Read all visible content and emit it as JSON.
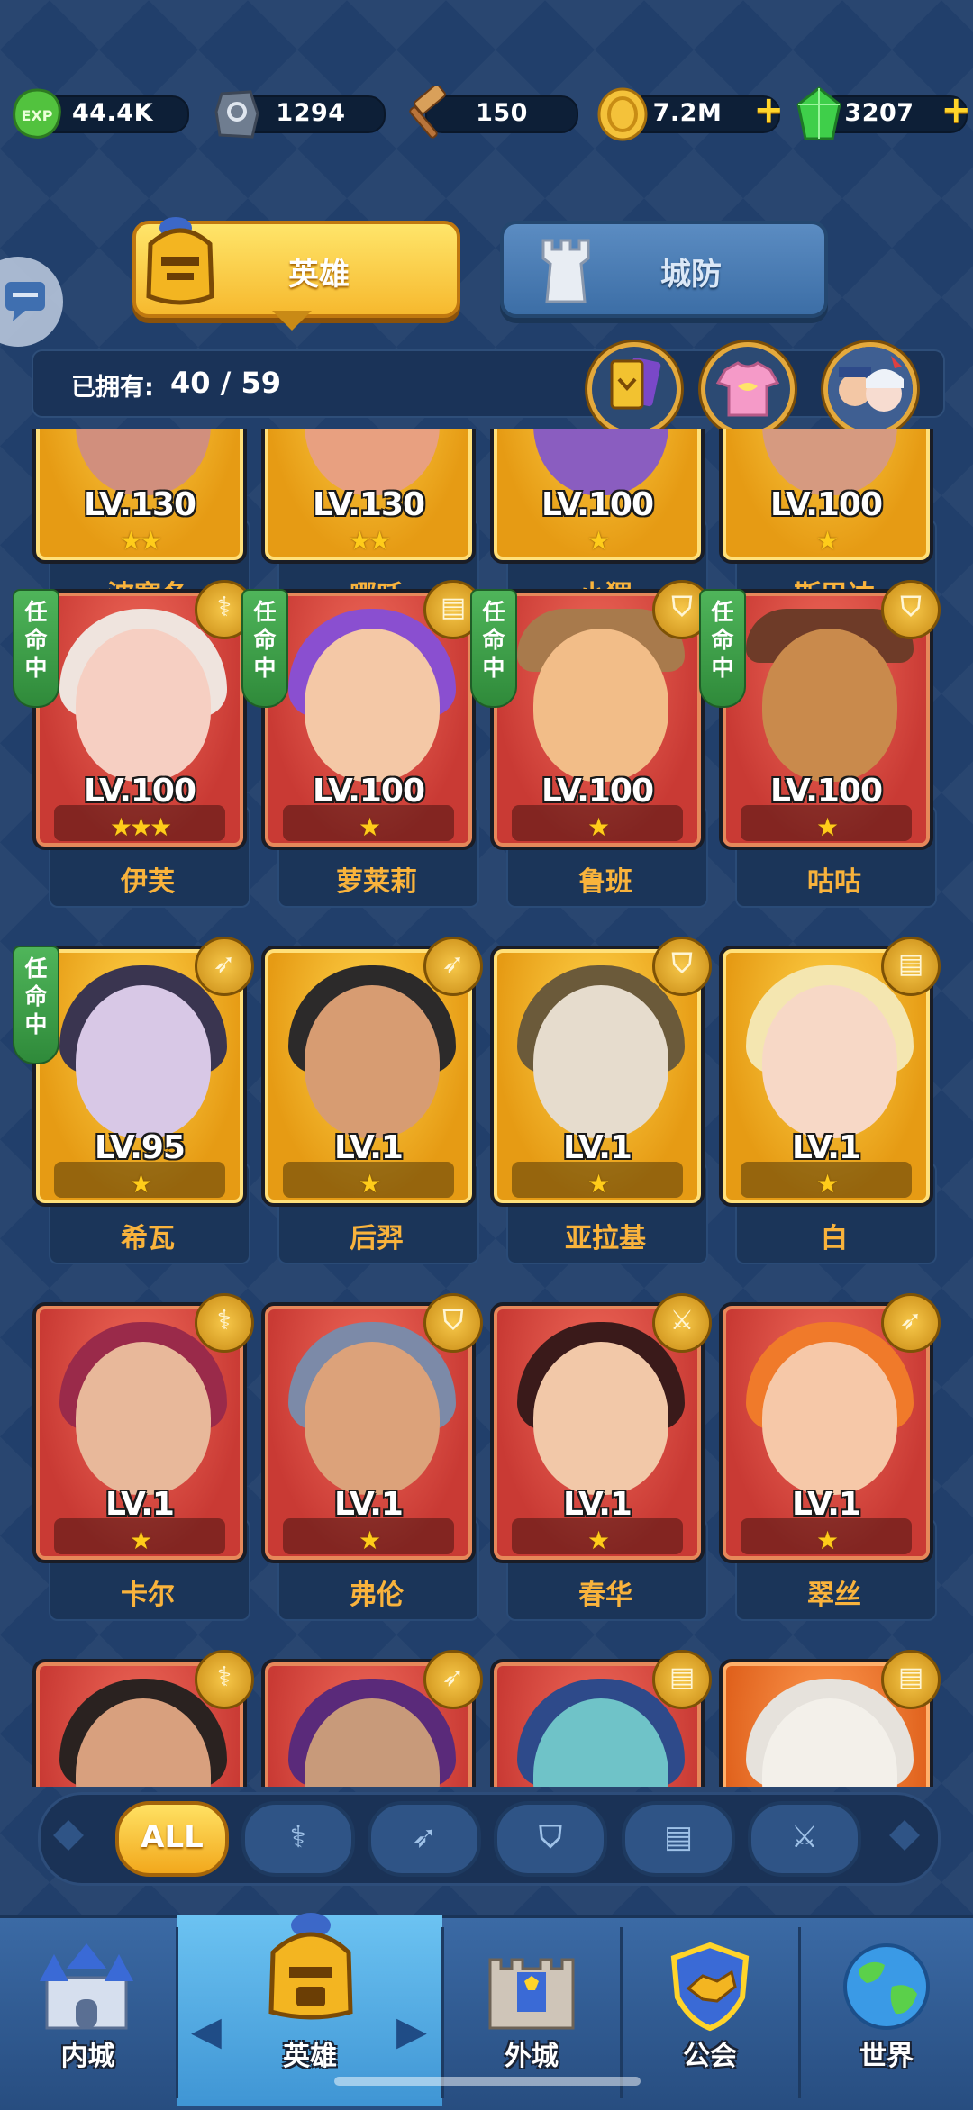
{
  "resources": [
    {
      "icon": "exp-icon",
      "value": "44.4K",
      "icon_text": "EXP",
      "color": "#55c943"
    },
    {
      "icon": "stone-icon",
      "value": "1294",
      "color": "#6d7a8c"
    },
    {
      "icon": "hammer-icon",
      "value": "150",
      "color": "#c08a4a"
    },
    {
      "icon": "coin-icon",
      "value": "7.2M",
      "color": "#f4c23a",
      "plus": "+"
    },
    {
      "icon": "gem-icon",
      "value": "3207",
      "color": "#3fcf4a",
      "plus": "+"
    }
  ],
  "tabs": {
    "hero": "英雄",
    "defense": "城防"
  },
  "owned": {
    "label": "已拥有:",
    "value": "40 / 59"
  },
  "task_tag": "任命中",
  "heroes_row0": [
    {
      "name": "波塞冬",
      "level": "LV.130",
      "stars": "★★",
      "frame": "gold"
    },
    {
      "name": "哪吒",
      "level": "LV.130",
      "stars": "★★",
      "frame": "gold"
    },
    {
      "name": "小狸",
      "level": "LV.100",
      "stars": "★",
      "frame": "gold"
    },
    {
      "name": "斯巴达",
      "level": "LV.100",
      "stars": "★",
      "frame": "gold"
    }
  ],
  "heroes_row1": [
    {
      "name": "伊芙",
      "level": "LV.100",
      "stars": "★★★",
      "frame": "red",
      "badge": "⚕",
      "task": true
    },
    {
      "name": "萝莱莉",
      "level": "LV.100",
      "stars": "★",
      "frame": "red",
      "badge": "▤",
      "task": true
    },
    {
      "name": "鲁班",
      "level": "LV.100",
      "stars": "★",
      "frame": "red",
      "badge": "⛉",
      "task": true
    },
    {
      "name": "咕咕",
      "level": "LV.100",
      "stars": "★",
      "frame": "red",
      "badge": "⛉",
      "task": true
    }
  ],
  "heroes_row2": [
    {
      "name": "希瓦",
      "level": "LV.95",
      "stars": "★",
      "frame": "gold",
      "badge": "➶",
      "task": true
    },
    {
      "name": "后羿",
      "level": "LV.1",
      "stars": "★",
      "frame": "gold",
      "badge": "➶"
    },
    {
      "name": "亚拉基",
      "level": "LV.1",
      "stars": "★",
      "frame": "gold",
      "badge": "⛉"
    },
    {
      "name": "白",
      "level": "LV.1",
      "stars": "★",
      "frame": "gold",
      "badge": "▤"
    }
  ],
  "heroes_row3": [
    {
      "name": "卡尔",
      "level": "LV.1",
      "stars": "★",
      "frame": "red",
      "badge": "⚕"
    },
    {
      "name": "弗伦",
      "level": "LV.1",
      "stars": "★",
      "frame": "red",
      "badge": "⛉"
    },
    {
      "name": "春华",
      "level": "LV.1",
      "stars": "★",
      "frame": "red",
      "badge": "⚔"
    },
    {
      "name": "翠丝",
      "level": "LV.1",
      "stars": "★",
      "frame": "red",
      "badge": "➶"
    }
  ],
  "heroes_row4": [
    {
      "frame": "red",
      "badge": "⚕"
    },
    {
      "frame": "red",
      "badge": "➶"
    },
    {
      "frame": "red",
      "badge": "▤"
    },
    {
      "frame": "orange",
      "badge": "▤"
    }
  ],
  "filters": [
    "ALL",
    "⚕",
    "➶",
    "⛉",
    "▤",
    "⚔"
  ],
  "nav": {
    "inner_city": "内城",
    "hero": "英雄",
    "outer_city": "外城",
    "guild": "公会",
    "world": "世界",
    "prev": "◀",
    "next": "▶"
  }
}
